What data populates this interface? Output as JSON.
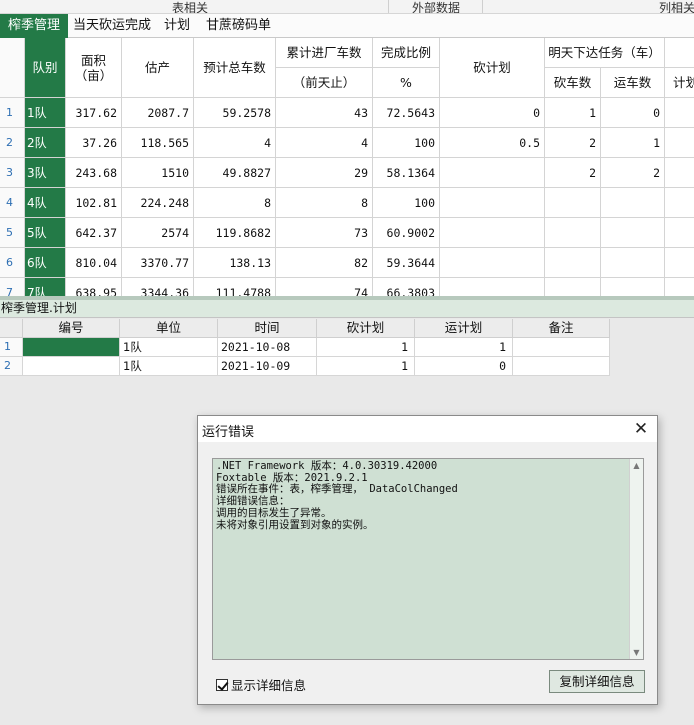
{
  "top_groups": {
    "g1": "表相关",
    "g2": "外部数据",
    "g3": "列相关"
  },
  "tabs": [
    "榨季管理",
    "当天砍运完成",
    "计划",
    "甘蔗磅码单"
  ],
  "grid1": {
    "headers": {
      "team": "队别",
      "area": "面积\n（亩）",
      "estimate": "估产",
      "trucks_est": "预计总车数",
      "cum_top": "累计进厂车数",
      "cum_sub": "（前天止）",
      "ratio_top": "完成比例",
      "ratio_sub": "%",
      "cut_plan": "砍计划",
      "tomorrow": "明天下达任务（车）",
      "cut_count": "砍车数",
      "haul_count": "运车数",
      "plan_more": "计划"
    },
    "rows": [
      {
        "n": "1",
        "team": "1队",
        "area": "317.62",
        "estimate": "2087.7",
        "trucks": "59.2578",
        "cum": "43",
        "ratio": "72.5643",
        "plan": "0",
        "cut": "1",
        "haul": "0"
      },
      {
        "n": "2",
        "team": "2队",
        "area": "37.26",
        "estimate": "118.565",
        "trucks": "4",
        "cum": "4",
        "ratio": "100",
        "plan": "0.5",
        "cut": "2",
        "haul": "1"
      },
      {
        "n": "3",
        "team": "3队",
        "area": "243.68",
        "estimate": "1510",
        "trucks": "49.8827",
        "cum": "29",
        "ratio": "58.1364",
        "plan": "",
        "cut": "2",
        "haul": "2"
      },
      {
        "n": "4",
        "team": "4队",
        "area": "102.81",
        "estimate": "224.248",
        "trucks": "8",
        "cum": "8",
        "ratio": "100",
        "plan": "",
        "cut": "",
        "haul": ""
      },
      {
        "n": "5",
        "team": "5队",
        "area": "642.37",
        "estimate": "2574",
        "trucks": "119.8682",
        "cum": "73",
        "ratio": "60.9002",
        "plan": "",
        "cut": "",
        "haul": ""
      },
      {
        "n": "6",
        "team": "6队",
        "area": "810.04",
        "estimate": "3370.77",
        "trucks": "138.13",
        "cum": "82",
        "ratio": "59.3644",
        "plan": "",
        "cut": "",
        "haul": ""
      },
      {
        "n": "7",
        "team": "7队",
        "area": "638.95",
        "estimate": "3344.36",
        "trucks": "111.4788",
        "cum": "74",
        "ratio": "66.3803",
        "plan": "",
        "cut": "",
        "haul": ""
      }
    ]
  },
  "subtable_caption": "榨季管理.计划",
  "grid2": {
    "headers": [
      "编号",
      "单位",
      "时间",
      "砍计划",
      "运计划",
      "备注"
    ],
    "rows": [
      {
        "n": "1",
        "id": "",
        "unit": "1队",
        "time": "2021-10-08",
        "cut": "1",
        "haul": "1",
        "note": ""
      },
      {
        "n": "2",
        "id": "",
        "unit": "1队",
        "time": "2021-10-09",
        "cut": "1",
        "haul": "0",
        "note": ""
      }
    ]
  },
  "dialog": {
    "title": "运行错误",
    "close_glyph": "✕",
    "message": ".NET Framework 版本：4.0.30319.42000\nFoxtable 版本：2021.9.2.1\n错误所在事件：表，榨季管理， DataColChanged\n详细错误信息：\n调用的目标发生了异常。\n未将对象引用设置到对象的实例。",
    "checkbox_label": "显示详细信息",
    "checkbox_checked": true,
    "copy_button": "复制详细信息"
  },
  "colors": {
    "accent": "#237a47",
    "selection_bg": "#cfe0d3"
  }
}
